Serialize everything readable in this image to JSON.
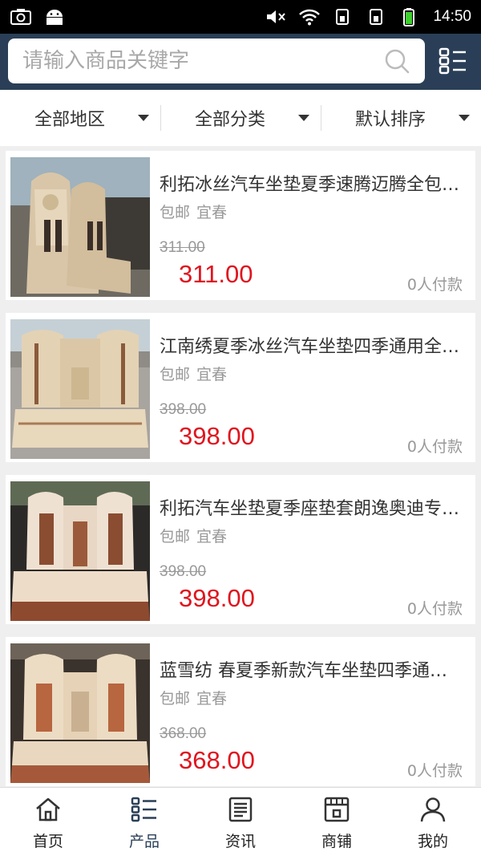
{
  "status_bar": {
    "time": "14:50"
  },
  "search": {
    "placeholder": "请输入商品关键字"
  },
  "filters": [
    {
      "label": "全部地区"
    },
    {
      "label": "全部分类"
    },
    {
      "label": "默认排序"
    }
  ],
  "products": [
    {
      "title": "利拓冰丝汽车坐垫夏季速腾迈腾全包围座垫套",
      "tags": [
        "包邮",
        "宜春"
      ],
      "old_price": "311.00",
      "price": "311.00",
      "paid": "0人付款"
    },
    {
      "title": "江南绣夏季冰丝汽车坐垫四季通用全包座垫",
      "tags": [
        "包邮",
        "宜春"
      ],
      "old_price": "398.00",
      "price": "398.00",
      "paid": "0人付款"
    },
    {
      "title": "利拓汽车坐垫夏季座垫套朗逸奥迪专用坐垫",
      "tags": [
        "包邮",
        "宜春"
      ],
      "old_price": "398.00",
      "price": "398.00",
      "paid": "0人付款"
    },
    {
      "title": "蓝雪纺 春夏季新款汽车坐垫四季通用座垫",
      "tags": [
        "包邮",
        "宜春"
      ],
      "old_price": "368.00",
      "price": "368.00",
      "paid": "0人付款"
    }
  ],
  "bottom_nav": [
    {
      "label": "首页",
      "icon": "home-icon"
    },
    {
      "label": "产品",
      "icon": "product-list-icon",
      "active": true
    },
    {
      "label": "资讯",
      "icon": "news-icon"
    },
    {
      "label": "商铺",
      "icon": "shop-icon"
    },
    {
      "label": "我的",
      "icon": "user-icon"
    }
  ],
  "colors": {
    "header": "#2a3f57",
    "price": "#e0141e",
    "background": "#efefef"
  }
}
